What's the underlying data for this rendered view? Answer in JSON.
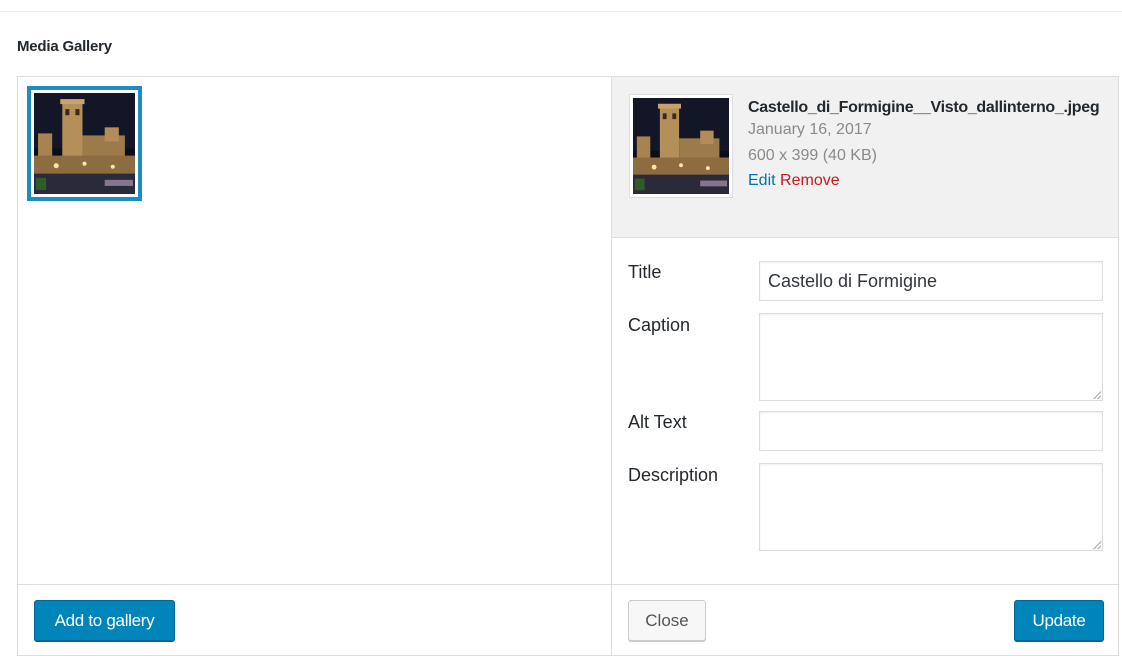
{
  "header": {
    "title": "Media Gallery"
  },
  "gallery": {
    "selected_thumbnail_icon": "castle-thumbnail-image"
  },
  "attachment": {
    "filename": "Castello_di_Formigine__Visto_dallinterno_.jpeg",
    "date": "January 16, 2017",
    "dimensions": "600 x 399 (40 KB)",
    "edit_label": "Edit",
    "remove_label": "Remove"
  },
  "fields": {
    "title_label": "Title",
    "title_value": "Castello di Formigine",
    "caption_label": "Caption",
    "caption_value": "",
    "alt_label": "Alt Text",
    "alt_value": "",
    "description_label": "Description",
    "description_value": ""
  },
  "footer": {
    "add_label": "Add to gallery",
    "close_label": "Close",
    "update_label": "Update"
  },
  "colors": {
    "primary": "#0085ba",
    "link": "#0073aa",
    "danger": "#cc1818",
    "selection": "#1e8cbe"
  }
}
